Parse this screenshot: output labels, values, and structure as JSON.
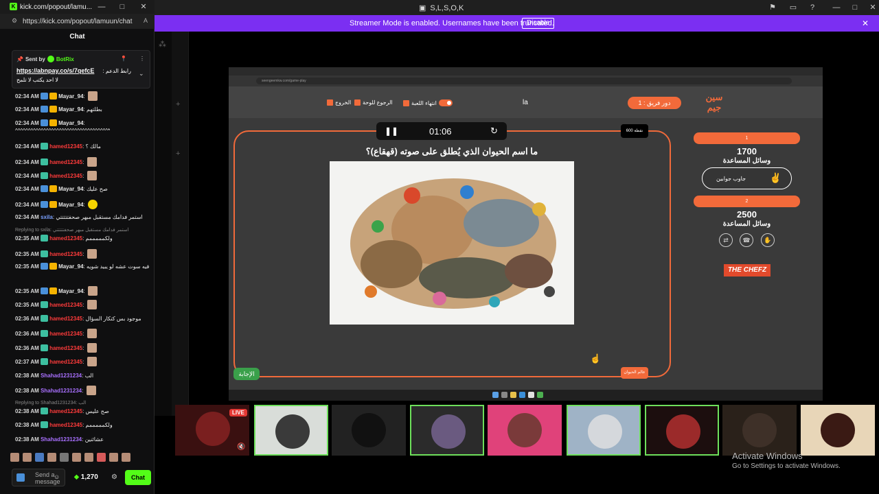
{
  "main_window": {
    "title": "S,L,S,O,K",
    "banner_text": "Streamer Mode is enabled. Usernames have been truncated.",
    "banner_button": "Disable",
    "banner_close": "✕"
  },
  "stream": {
    "url": "seengeemkw.com/game-play",
    "header": {
      "exit": "الخروج",
      "back_to_board": "الرجوع للوحة",
      "end_game": "انتهاء اللعبة",
      "center": "la",
      "turn": "دور فريق : 1",
      "logo": "سين جيم"
    },
    "timer": "01:06",
    "points_badge": "600 نقطة",
    "question": "ما اسم الحيوان الذي يُطلق على صوته (قهقاع)؟",
    "answer_button": "الإجابة",
    "category": "عالم الحيوان",
    "team1": {
      "label": "1",
      "score": "1700",
      "help": "وسائل المساعدة",
      "lifeline": "جاوب جوابين"
    },
    "team2": {
      "label": "2",
      "score": "2500",
      "help": "وسائل المساعدة"
    },
    "sponsor": "THE CHEFZ"
  },
  "tiles": {
    "live": "LIVE"
  },
  "watermark": {
    "title": "Activate Windows",
    "subtitle": "Go to Settings to activate Windows."
  },
  "chat": {
    "tab_title": "kick.com/popout/lamu...",
    "url": "https://kick.com/popout/lamuun/chat",
    "heading": "Chat",
    "pinned": {
      "sent_by": "Sent by",
      "bot": "BotRix",
      "link": "https://abnpay.co/s/7qefcE",
      "link_label": ": رابط الدعم",
      "line2": "لا احد يكتب لا تلمح"
    },
    "messages": [
      {
        "time": "02:34 AM",
        "user": "Mayar_94",
        "text": ""
      },
      {
        "time": "02:34 AM",
        "user": "Mayar_94",
        "text": "بطلتهم"
      },
      {
        "time": "02:34 AM",
        "user": "Mayar_94",
        "text": "^^^^^^^^^^^^^^^^^^^^^^^^^^^^^^^^^^^^*"
      },
      {
        "time": "02:34 AM",
        "user": "hamed12345",
        "text": "مالك ؟"
      },
      {
        "time": "02:34 AM",
        "user": "hamed12345",
        "text": ""
      },
      {
        "time": "02:34 AM",
        "user": "hamed12345",
        "text": ""
      },
      {
        "time": "02:34 AM",
        "user": "Mayar_94",
        "text": "صح عليك"
      },
      {
        "time": "02:34 AM",
        "user": "Mayar_94",
        "text": ""
      },
      {
        "time": "02:34 AM",
        "user": "sxila",
        "text": "استمر فدامك مستقبل مبهر صحفتتتتتي"
      },
      {
        "time": "02:35 AM",
        "user": "hamed12345",
        "text": "ولكمممممم"
      },
      {
        "time": "02:35 AM",
        "user": "hamed12345",
        "text": ""
      },
      {
        "time": "02:35 AM",
        "user": "Mayar_94",
        "text": "فيه سوت عشه لو يبيد شويه"
      },
      {
        "time": "02:35 AM",
        "user": "Mayar_94",
        "text": ""
      },
      {
        "time": "02:35 AM",
        "user": "hamed12345",
        "text": ""
      },
      {
        "time": "02:36 AM",
        "user": "hamed12345",
        "text": "موجود بس كتكار السؤال"
      },
      {
        "time": "02:36 AM",
        "user": "hamed12345",
        "text": ""
      },
      {
        "time": "02:36 AM",
        "user": "hamed12345",
        "text": ""
      },
      {
        "time": "02:37 AM",
        "user": "hamed12345",
        "text": ""
      },
      {
        "time": "02:38 AM",
        "user": "Shahad1231234",
        "text": "الب"
      },
      {
        "time": "02:38 AM",
        "user": "Shahad1231234",
        "text": ""
      },
      {
        "time": "02:38 AM",
        "user": "hamed12345",
        "text": "صح عليس"
      },
      {
        "time": "02:38 AM",
        "user": "hamed12345",
        "text": "ولكمممممم"
      },
      {
        "time": "02:38 AM",
        "user": "Shahad1231234",
        "text": "عشائنين"
      }
    ],
    "reply1": "Replying to sxila: استمر فدامك مستقبل مبهر صحفتتتتتي",
    "reply2": "Replying to Shahad1231234: الب",
    "input_placeholder": "Send a message",
    "points": "1,270",
    "send": "Chat"
  }
}
